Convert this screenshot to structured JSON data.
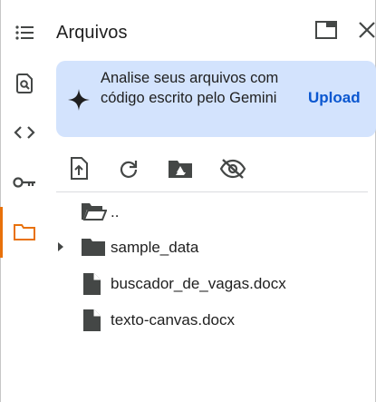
{
  "header": {
    "title": "Arquivos"
  },
  "gemini_card": {
    "message": "Analise seus arquivos com código escrito pelo Gemini",
    "upload_label": "Upload"
  },
  "rail": {
    "items": [
      {
        "icon": "table-of-contents-icon"
      },
      {
        "icon": "find-replace-icon"
      },
      {
        "icon": "code-snippets-icon"
      },
      {
        "icon": "key-icon"
      },
      {
        "icon": "folder-icon",
        "active": true
      }
    ]
  },
  "toolbar": {
    "icons": [
      "upload-file-icon",
      "refresh-icon",
      "mount-drive-icon",
      "hide-icon"
    ]
  },
  "files": [
    {
      "name": "..",
      "type": "parent-folder"
    },
    {
      "name": "sample_data",
      "type": "folder",
      "expandable": true
    },
    {
      "name": "buscador_de_vagas.docx",
      "type": "file"
    },
    {
      "name": "texto-canvas.docx",
      "type": "file"
    }
  ],
  "colors": {
    "accent": "#e8710a",
    "card_bg": "#d3e3fd",
    "link": "#0b57d0",
    "icon": "#444746"
  }
}
